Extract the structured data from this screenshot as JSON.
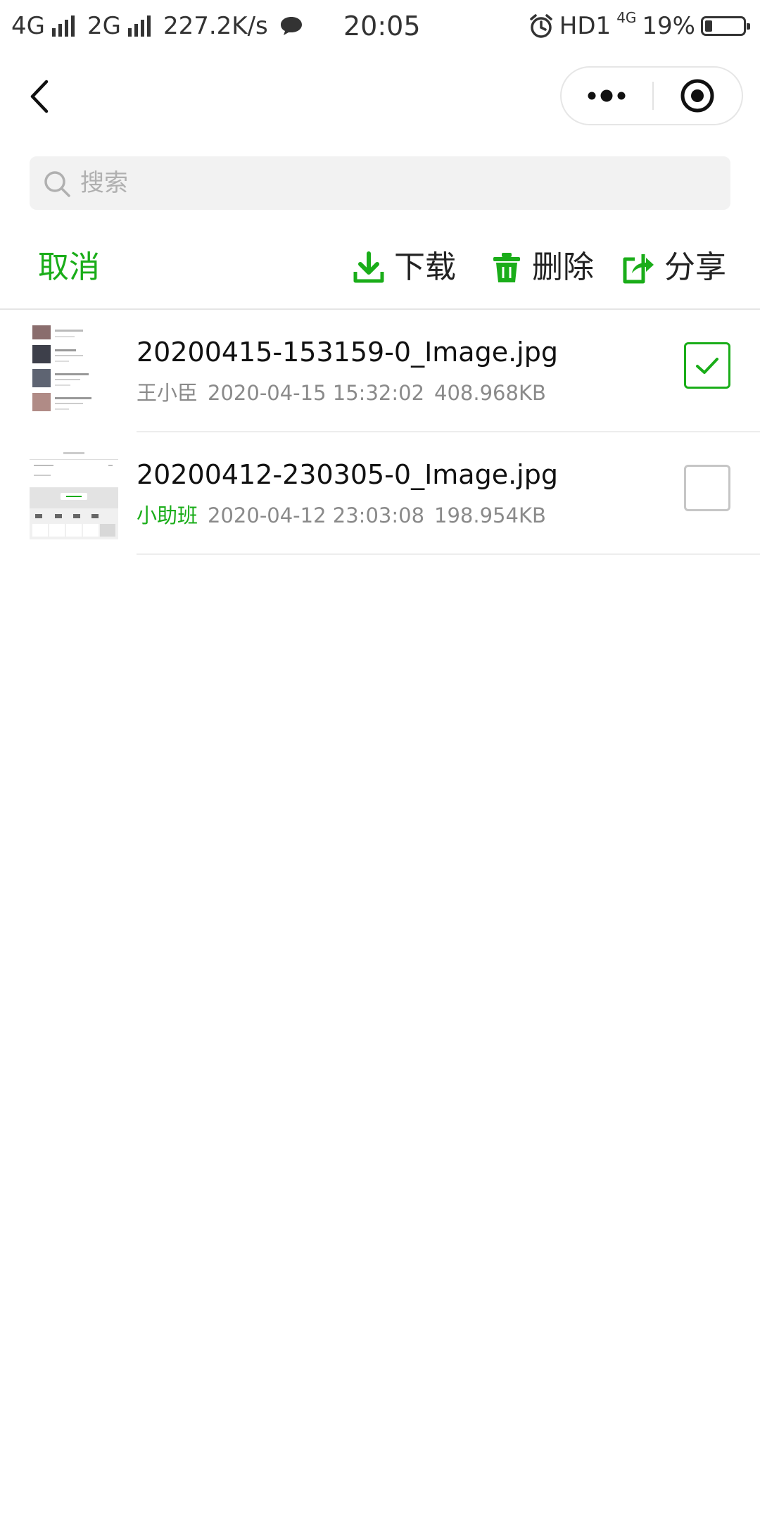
{
  "status_bar": {
    "network_1": "4G",
    "network_2": "2G",
    "speed": "227.2K/s",
    "time": "20:05",
    "hd": "HD1",
    "network_small": "4G",
    "battery": "19%",
    "battery_level": 0.19
  },
  "search": {
    "placeholder": "搜索"
  },
  "toolbar": {
    "cancel": "取消",
    "download": "下载",
    "delete": "删除",
    "share": "分享"
  },
  "colors": {
    "accent": "#1aad19",
    "meta_gray": "#8a8a8a"
  },
  "files": [
    {
      "name": "20200415-153159-0_Image.jpg",
      "sender": "王小臣",
      "date": "2020-04-15 15:32:02",
      "size": "408.968KB",
      "selected": true
    },
    {
      "name": "20200412-230305-0_Image.jpg",
      "sender": "小助班",
      "date": "2020-04-12 23:03:08",
      "size": "198.954KB",
      "selected": false
    }
  ]
}
